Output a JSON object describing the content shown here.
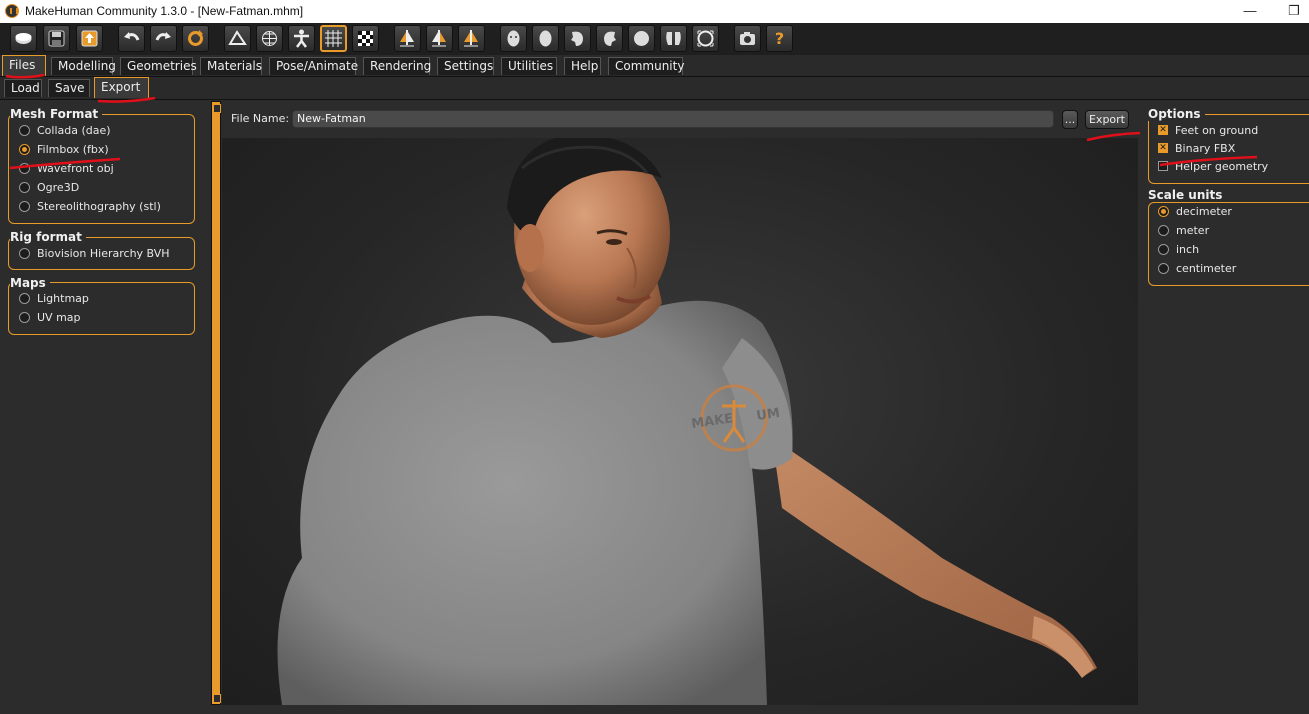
{
  "window": {
    "title": "MakeHuman Community 1.3.0 - [New-Fatman.mhm]",
    "minimize_glyph": "—",
    "restore_glyph": "❐"
  },
  "toolbar": {
    "icons": [
      "new-file-icon",
      "save-icon",
      "export-icon",
      "undo-icon",
      "redo-icon",
      "reset-icon",
      "smooth-icon",
      "wireframe-icon",
      "pose-icon",
      "grid-icon",
      "checker-icon",
      "symmetry-right-icon",
      "symmetry-left-icon",
      "symmetry-icon",
      "front-view-icon",
      "back-view-icon",
      "left-view-icon",
      "right-view-icon",
      "top-view-icon",
      "bottom-view-icon",
      "reset-camera-icon",
      "screenshot-icon",
      "help-icon"
    ]
  },
  "main_tabs": [
    "Files",
    "Modelling",
    "Geometries",
    "Materials",
    "Pose/Animate",
    "Rendering",
    "Settings",
    "Utilities",
    "Help",
    "Community"
  ],
  "sub_tabs": [
    "Load",
    "Save",
    "Export"
  ],
  "left": {
    "mesh_format": {
      "title": "Mesh Format",
      "options": [
        "Collada (dae)",
        "Filmbox (fbx)",
        "Wavefront obj",
        "Ogre3D",
        "Stereolithography (stl)"
      ],
      "selected": "Filmbox (fbx)"
    },
    "rig_format": {
      "title": "Rig format",
      "options": [
        "Biovision Hierarchy BVH"
      ]
    },
    "maps": {
      "title": "Maps",
      "options": [
        "Lightmap",
        "UV map"
      ]
    }
  },
  "file": {
    "label": "File Name:",
    "value": "New-Fatman",
    "browse_label": "...",
    "export_label": "Export"
  },
  "right": {
    "options": {
      "title": "Options",
      "items": [
        {
          "label": "Feet on ground",
          "checked": true
        },
        {
          "label": "Binary FBX",
          "checked": true
        },
        {
          "label": "Helper geometry",
          "checked": false
        }
      ]
    },
    "scale_units": {
      "title": "Scale units",
      "options": [
        "decimeter",
        "meter",
        "inch",
        "centimeter"
      ],
      "selected": "decimeter"
    }
  },
  "viewport": {
    "shirt_logo_text": "MAKE",
    "shirt_logo_text2": "UM"
  },
  "colors": {
    "accent": "#e89a2a",
    "annotation": "#e0101a",
    "panel_bg": "#2c2c2c"
  }
}
